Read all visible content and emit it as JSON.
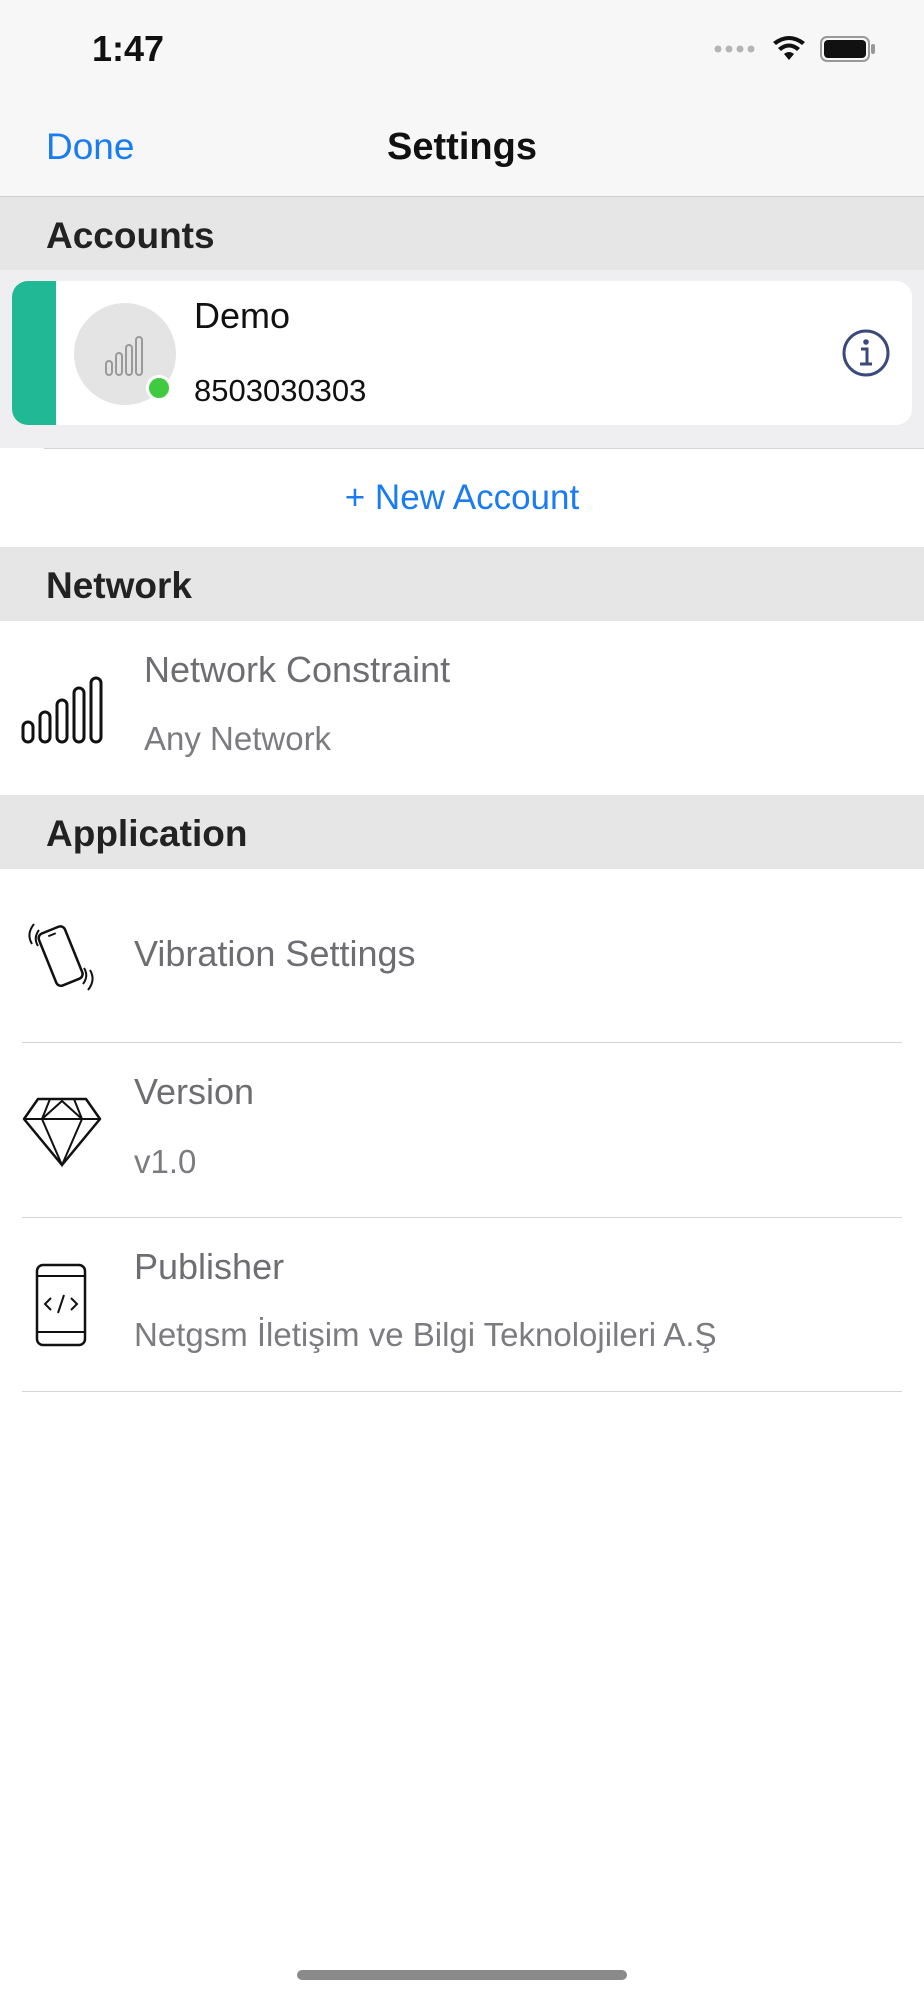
{
  "status_bar": {
    "time": "1:47",
    "icons": [
      "signal-dots-icon",
      "wifi-icon",
      "battery-icon"
    ]
  },
  "nav": {
    "done_label": "Done",
    "title": "Settings"
  },
  "sections": {
    "accounts": "Accounts",
    "network": "Network",
    "application": "Application"
  },
  "account": {
    "name": "Demo",
    "number": "8503030303",
    "status": "online",
    "accent_color": "#20b895",
    "online_color": "#3fcb3f"
  },
  "new_account_label": "+ New Account",
  "network": {
    "constraint_title": "Network Constraint",
    "constraint_value": "Any Network"
  },
  "application": {
    "vibration_title": "Vibration Settings",
    "version_title": "Version",
    "version_value": "v1.0",
    "publisher_title": "Publisher",
    "publisher_value": "Netgsm İletişim ve Bilgi Teknolojileri A.Ş"
  },
  "colors": {
    "link_blue": "#1a7cf2",
    "info_icon": "#3a4a7a"
  }
}
